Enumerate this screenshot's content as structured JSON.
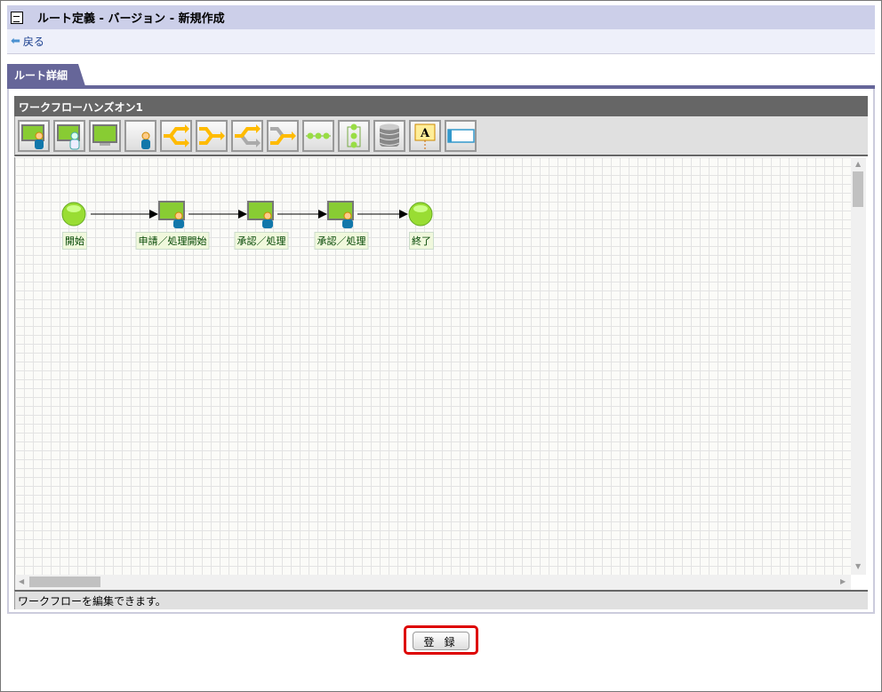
{
  "header": {
    "title": "ルート定義 - バージョン - 新規作成",
    "back_label": "戻る"
  },
  "tab": {
    "label": "ルート詳細"
  },
  "workflow": {
    "name": "ワークフローハンズオン1",
    "toolbar": [
      "user-task-icon",
      "multi-user-task-icon",
      "system-task-icon",
      "user-icon",
      "branch-icon",
      "merge-icon",
      "branch-alt-icon",
      "merge-alt-icon",
      "horizontal-nodes-icon",
      "vertical-nodes-icon",
      "database-icon",
      "text-label-icon",
      "frame-icon"
    ],
    "nodes": [
      {
        "type": "start",
        "label": "開始"
      },
      {
        "type": "task",
        "label": "申請／処理開始"
      },
      {
        "type": "task",
        "label": "承認／処理"
      },
      {
        "type": "task",
        "label": "承認／処理"
      },
      {
        "type": "end",
        "label": "終了"
      }
    ],
    "status": "ワークフローを編集できます。"
  },
  "register_label": "登 録"
}
